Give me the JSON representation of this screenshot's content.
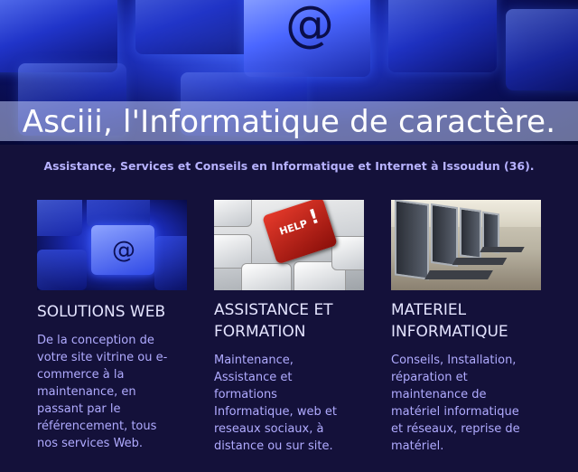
{
  "header": {
    "title": "Asciii, l'Informatique de caractère.",
    "subtitle": "Assistance, Services et Conseils en Informatique et Internet à Issoudun (36)."
  },
  "services": [
    {
      "heading": "SOLUTIONS WEB",
      "text": "De la conception de\nvotre site vitrine ou e-\ncommerce à la\nmaintenance, en\npassant par le\nréférencement, tous\nnos services Web."
    },
    {
      "heading": "ASSISTANCE ET\n FORMATION",
      "text": "Maintenance,\nAssistance et\nformations\nInformatique, web et\nreseaux sociaux, à\ndistance ou sur site."
    },
    {
      "heading": "MATERIEL\nINFORMATIQUE",
      "text": "Conseils, Installation,\nréparation  et\nmaintenance de\nmatériel informatique\net réseaux, reprise de\nmatériel."
    }
  ],
  "images": {
    "hero_key_symbol": "@",
    "web_key_symbol": "@",
    "help_key_label": "HELP",
    "help_key_mark": "!"
  }
}
